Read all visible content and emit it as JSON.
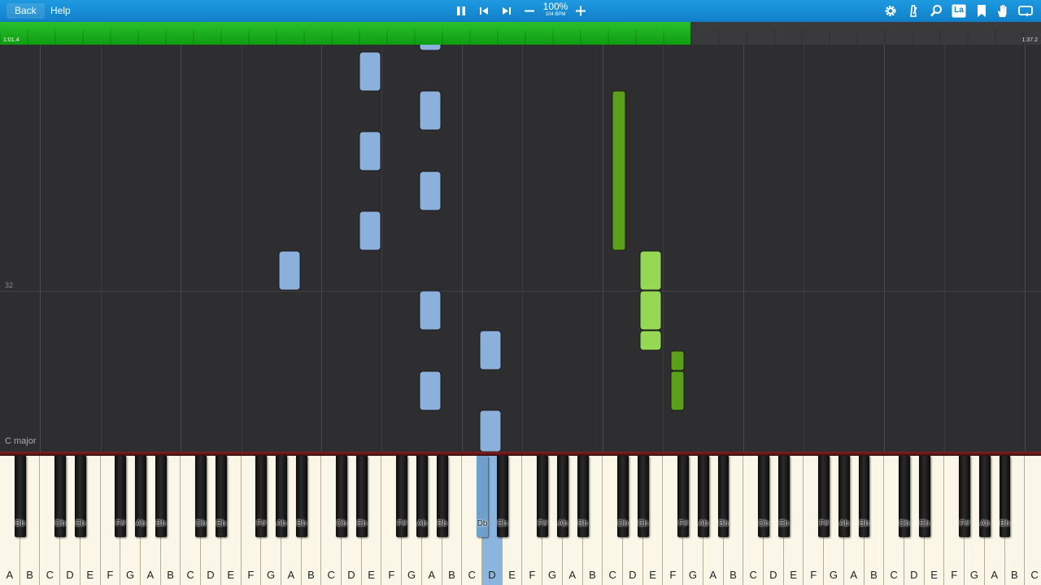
{
  "toolbar": {
    "back_label": "Back",
    "help_label": "Help",
    "tempo_percent": "100%",
    "tempo_bpm": "104 BPM",
    "controls": {
      "pause": "pause-icon",
      "previous": "skip-previous-icon",
      "next": "skip-next-icon",
      "slower": "minus-icon",
      "faster": "plus-icon"
    },
    "right_icons": [
      "gear-icon",
      "metronome-icon",
      "magnifier-icon",
      "note-label-icon",
      "bookmark-icon",
      "hand-icon",
      "loop-icon"
    ],
    "note_label_text": "La"
  },
  "progress": {
    "fraction": 0.663,
    "current_time": "1:01.4",
    "total_time": "1:37.2"
  },
  "roll": {
    "measure_number": "32",
    "key_signature": "C major",
    "colors": {
      "background": "#2e2e30",
      "left_hand": "#8cb0dc",
      "right_hand_light": "#94d853",
      "right_hand_dark": "#5aa01a"
    }
  },
  "keyboard": {
    "white_keys": [
      "A",
      "B",
      "C",
      "D",
      "E",
      "F",
      "G",
      "A",
      "B",
      "C",
      "D",
      "E",
      "F",
      "G",
      "A",
      "B",
      "C",
      "D",
      "E",
      "F",
      "G",
      "A",
      "B",
      "C",
      "D",
      "E",
      "F",
      "G",
      "A",
      "B",
      "C",
      "D",
      "E",
      "F",
      "G",
      "A",
      "B",
      "C",
      "D",
      "E",
      "F",
      "G",
      "A",
      "B",
      "C",
      "D",
      "E",
      "F",
      "G",
      "A",
      "B",
      "C"
    ],
    "black_keys": [
      "Bb",
      "Db",
      "Eb",
      "F#",
      "Ab",
      "Bb",
      "Db",
      "Eb",
      "F#",
      "Ab",
      "Bb",
      "Db",
      "Eb",
      "F#",
      "Ab",
      "Bb",
      "Db",
      "Eb",
      "F#",
      "Ab",
      "Bb",
      "Db",
      "Eb",
      "F#",
      "Ab",
      "Bb",
      "Db",
      "Eb",
      "F#",
      "Ab",
      "Bb",
      "Db",
      "Eb",
      "F#",
      "Ab",
      "Bb"
    ],
    "active_white_index": 24,
    "active_color": "#8cb5dd"
  }
}
